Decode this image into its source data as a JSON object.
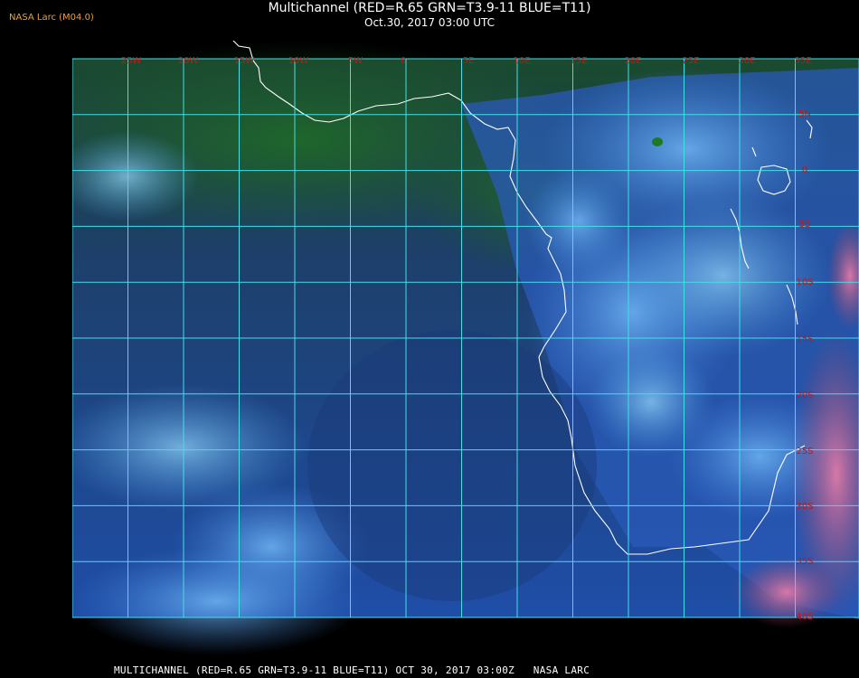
{
  "header": {
    "producer": "NASA Larc (M04.0)",
    "title": "Multichannel (RED=R.65 GRN=T3.9-11 BLUE=T11)",
    "datetime": "Oct.30, 2017 03:00 UTC"
  },
  "map": {
    "lon_labels": [
      "25W",
      "20W",
      "15W",
      "10W",
      "5W",
      "0",
      "5E",
      "10E",
      "15E",
      "20E",
      "25E",
      "30E",
      "35E"
    ],
    "lat_labels": [
      "5N",
      "0",
      "5S",
      "10S",
      "15S",
      "20S",
      "25S",
      "30S",
      "35S",
      "40S"
    ],
    "colors": {
      "grid": "#40e0e8",
      "labels": "#c01818",
      "coast": "#ffffff",
      "ocean": "#1d4a9a",
      "cloud": "#4a9ae0",
      "vegetation": "#1f5a26",
      "desert": "#d0608a"
    }
  },
  "footer": {
    "caption": "MULTICHANNEL (RED=R.65 GRN=T3.9-11 BLUE=T11) OCT 30, 2017 03:00Z   NASA LARC"
  }
}
